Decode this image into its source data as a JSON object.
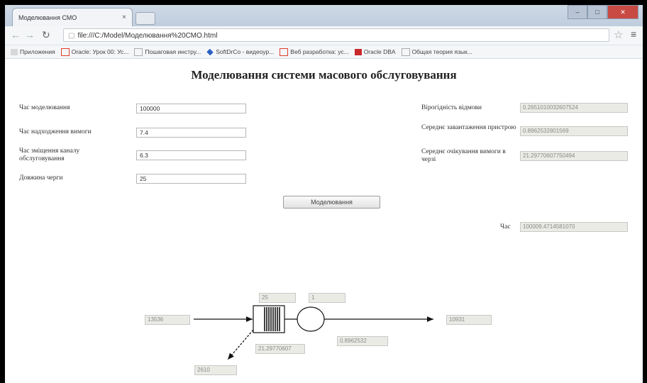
{
  "browser": {
    "tab_title": "Моделювання СМО",
    "tab_close": "×",
    "url": "file:///C:/Model/Моделювання%20СМО.html",
    "bookmarks": [
      "Приложения",
      "Oracle: Урок 00: Ус...",
      "Пошаговая инстру...",
      "SoftDrCo - видеоур...",
      "Веб разработка: ус...",
      "Oracle DBA",
      "Общая теория язык..."
    ]
  },
  "page": {
    "title": "Моделювання системи масового обслуговування",
    "inputs": [
      {
        "label": "Час моделювання",
        "value": "100000"
      },
      {
        "label": "Час надходження вимоги",
        "value": "7.4"
      },
      {
        "label": "Час зміщення каналу обслуговування",
        "value": "6.3"
      },
      {
        "label": "Довжина черги",
        "value": "25"
      }
    ],
    "results": [
      {
        "label": "Вірогідність відмови",
        "value": "0.2651010032607524"
      },
      {
        "label": "Середнє завантаження пристрою",
        "value": "0.8962532801569"
      },
      {
        "label": "Середнє очікування вимоги в черзі",
        "value": "21.29770607750494"
      }
    ],
    "model_button": "Моделювання",
    "time_label": "Час",
    "time_value": "100009.4714581070"
  },
  "diagram": {
    "incoming": "13536",
    "queue_capacity": "25",
    "server_count": "1",
    "queue_wait": "21.29770607",
    "utilization": "0.8962532",
    "served": "10931",
    "rejected": "2610"
  }
}
